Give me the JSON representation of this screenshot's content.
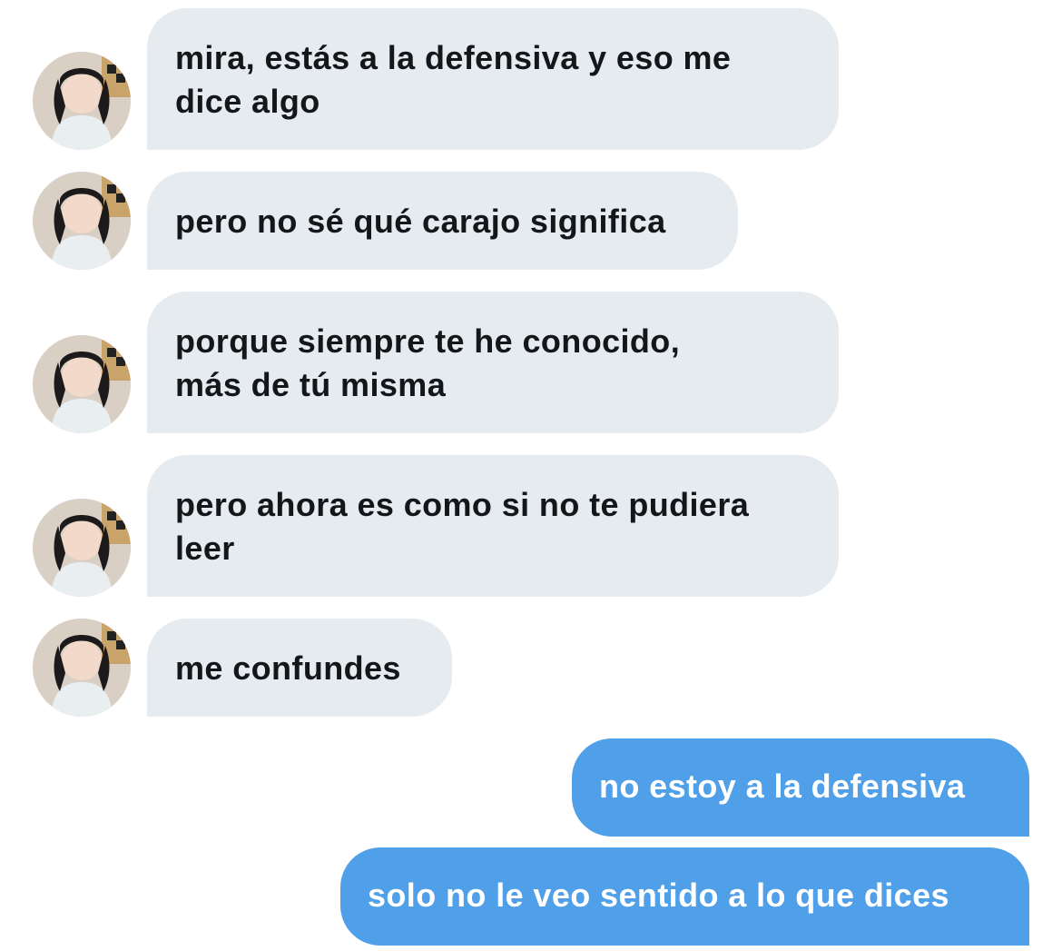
{
  "conversation": {
    "incoming": [
      {
        "text": "mira, estás a la defensiva y eso me\ndice algo"
      },
      {
        "text": "pero no sé qué carajo significa"
      },
      {
        "text": "porque siempre te he conocido,\nmás de tú misma"
      },
      {
        "text": "pero ahora es como si no te pudiera\nleer"
      },
      {
        "text": "me confundes"
      }
    ],
    "outgoing": [
      {
        "text": "no estoy a la defensiva"
      },
      {
        "text": "solo no le veo sentido a lo que dices"
      }
    ]
  },
  "colors": {
    "incoming_bubble": "#e6ebf0",
    "incoming_text": "#14171a",
    "outgoing_bubble": "#4f9fe9",
    "outgoing_text": "#ffffff"
  },
  "icons": {
    "avatar": "profile-photo-avatar"
  }
}
